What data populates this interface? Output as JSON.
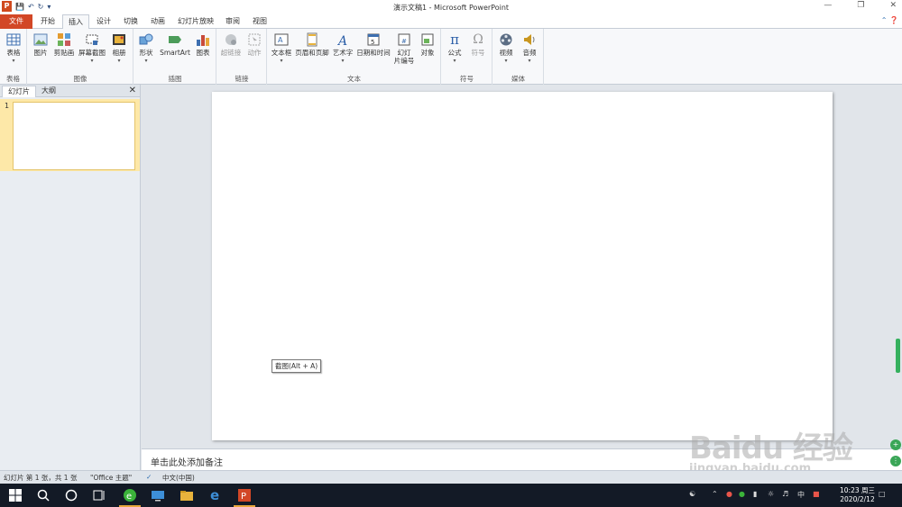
{
  "app": {
    "title": "演示文稿1 - Microsoft PowerPoint",
    "logo_letter": "P"
  },
  "qat": {
    "save_icon": "save-icon",
    "undo_icon": "undo-icon",
    "redo_icon": "redo-icon"
  },
  "tabs": [
    {
      "label": "文件"
    },
    {
      "label": "开始"
    },
    {
      "label": "插入"
    },
    {
      "label": "设计"
    },
    {
      "label": "切换"
    },
    {
      "label": "动画"
    },
    {
      "label": "幻灯片放映"
    },
    {
      "label": "审阅"
    },
    {
      "label": "视图"
    }
  ],
  "ribbon": {
    "groups": {
      "table": "表格",
      "images": "图像",
      "illustrations": "插图",
      "links": "链接",
      "text": "文本",
      "symbols": "符号",
      "media": "媒体"
    },
    "buttons": {
      "table": "表格",
      "picture": "图片",
      "clipart": "剪贴画",
      "screenshot": "屏幕截图",
      "album": "相册",
      "shapes": "形状",
      "smartart": "SmartArt",
      "chart": "图表",
      "hyperlink": "超链接",
      "action": "动作",
      "textbox": "文本框",
      "headerfooter": "页眉和页脚",
      "wordart": "艺术字",
      "datetime": "日期和时间",
      "slidenum_1": "幻灯",
      "slidenum_2": "片编号",
      "object": "对象",
      "equation": "公式",
      "symbol": "符号",
      "video": "视频",
      "audio": "音频"
    }
  },
  "leftpane": {
    "tab_slides": "幻灯片",
    "tab_outline": "大纲",
    "slide_number": "1"
  },
  "tooltip": "截图(Alt + A)",
  "notes": {
    "placeholder": "单击此处添加备注"
  },
  "status": {
    "slide_info": "幻灯片 第 1 张，共 1 张",
    "theme": "\"Office 主题\"",
    "language": "中文(中国)"
  },
  "taskbar": {
    "time": "10:23 周三",
    "date": "2020/2/12",
    "ime": "中"
  },
  "watermark": {
    "main": "Baidu 经验",
    "sub": "jingyan.baidu.com"
  },
  "colors": {
    "file_tab": "#d24726",
    "accent": "#2b6cb0",
    "taskbar": "#131a26"
  }
}
